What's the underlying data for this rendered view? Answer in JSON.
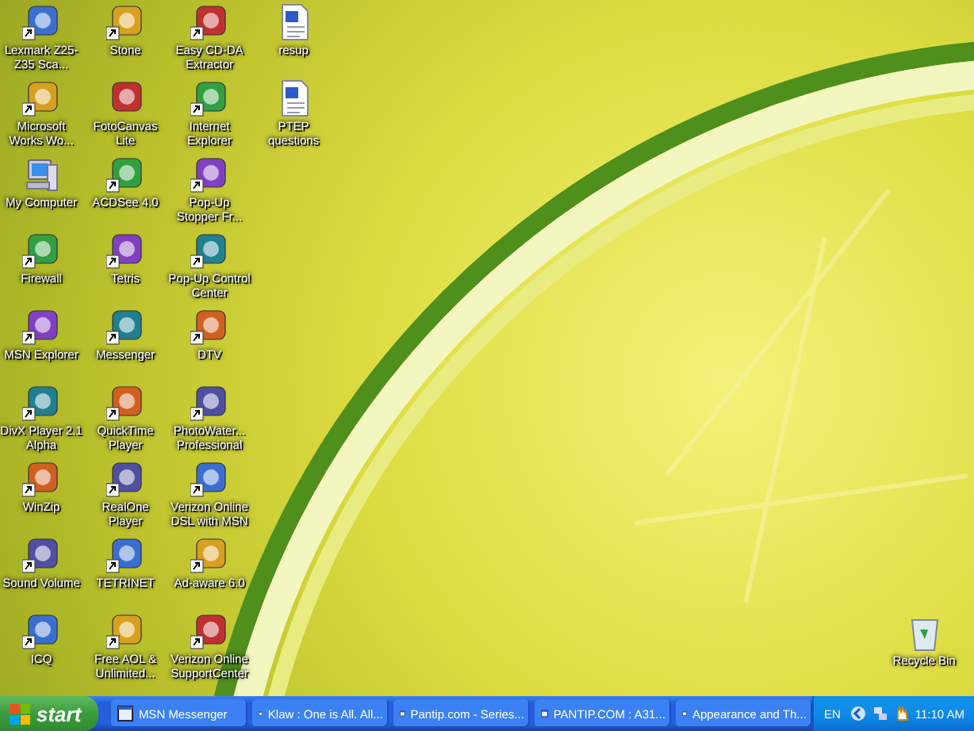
{
  "desktop_icons": [
    {
      "label": "Lexmark Z25-Z35 Sca...",
      "kind": "program",
      "shortcut": true
    },
    {
      "label": "Microsoft Works Wo...",
      "kind": "program",
      "shortcut": true
    },
    {
      "label": "My Computer",
      "kind": "computer",
      "shortcut": false
    },
    {
      "label": "Firewall",
      "kind": "program",
      "shortcut": true
    },
    {
      "label": "MSN Explorer",
      "kind": "program",
      "shortcut": true
    },
    {
      "label": "DivX Player 2.1 Alpha",
      "kind": "program",
      "shortcut": true
    },
    {
      "label": "WinZip",
      "kind": "program",
      "shortcut": true
    },
    {
      "label": "Sound Volume",
      "kind": "program",
      "shortcut": true
    },
    {
      "label": "ICQ",
      "kind": "program",
      "shortcut": true
    },
    {
      "label": "Stone",
      "kind": "program",
      "shortcut": true
    },
    {
      "label": "FotoCanvas Lite",
      "kind": "program",
      "shortcut": false
    },
    {
      "label": "ACDSee 4.0",
      "kind": "program",
      "shortcut": true
    },
    {
      "label": "Tetris",
      "kind": "program",
      "shortcut": true
    },
    {
      "label": "Messenger",
      "kind": "program",
      "shortcut": true
    },
    {
      "label": "QuickTime Player",
      "kind": "program",
      "shortcut": true
    },
    {
      "label": "RealOne Player",
      "kind": "program",
      "shortcut": true
    },
    {
      "label": "TETRINET",
      "kind": "program",
      "shortcut": true
    },
    {
      "label": "Free AOL & Unlimited...",
      "kind": "program",
      "shortcut": true
    },
    {
      "label": "Easy CD-DA Extractor",
      "kind": "program",
      "shortcut": true
    },
    {
      "label": "Internet Explorer",
      "kind": "program",
      "shortcut": true
    },
    {
      "label": "Pop-Up Stopper Fr...",
      "kind": "program",
      "shortcut": true
    },
    {
      "label": "Pop-Up Control Center",
      "kind": "program",
      "shortcut": true
    },
    {
      "label": "DTV",
      "kind": "program",
      "shortcut": true
    },
    {
      "label": "PhotoWater... Professional",
      "kind": "program",
      "shortcut": true
    },
    {
      "label": "Verizon Online DSL with MSN",
      "kind": "program",
      "shortcut": true
    },
    {
      "label": "Ad-aware 6.0",
      "kind": "program",
      "shortcut": true
    },
    {
      "label": "Verizon Online SupportCenter",
      "kind": "program",
      "shortcut": true
    },
    {
      "label": "resup",
      "kind": "document",
      "shortcut": false
    },
    {
      "label": "PTEP questions",
      "kind": "document",
      "shortcut": false
    }
  ],
  "recycle_bin": {
    "label": "Recycle Bin"
  },
  "taskbar": {
    "start_label": "start",
    "tasks": [
      {
        "label": "MSN Messenger",
        "selected": false
      },
      {
        "label": "Klaw : One is All. All...",
        "selected": false
      },
      {
        "label": "Pantip.com - Series...",
        "selected": false
      },
      {
        "label": "PANTIP.COM : A31...",
        "selected": false
      },
      {
        "label": "Appearance and Th...",
        "selected": false
      }
    ],
    "tray": {
      "language": "EN",
      "clock": "11:10 AM"
    }
  }
}
